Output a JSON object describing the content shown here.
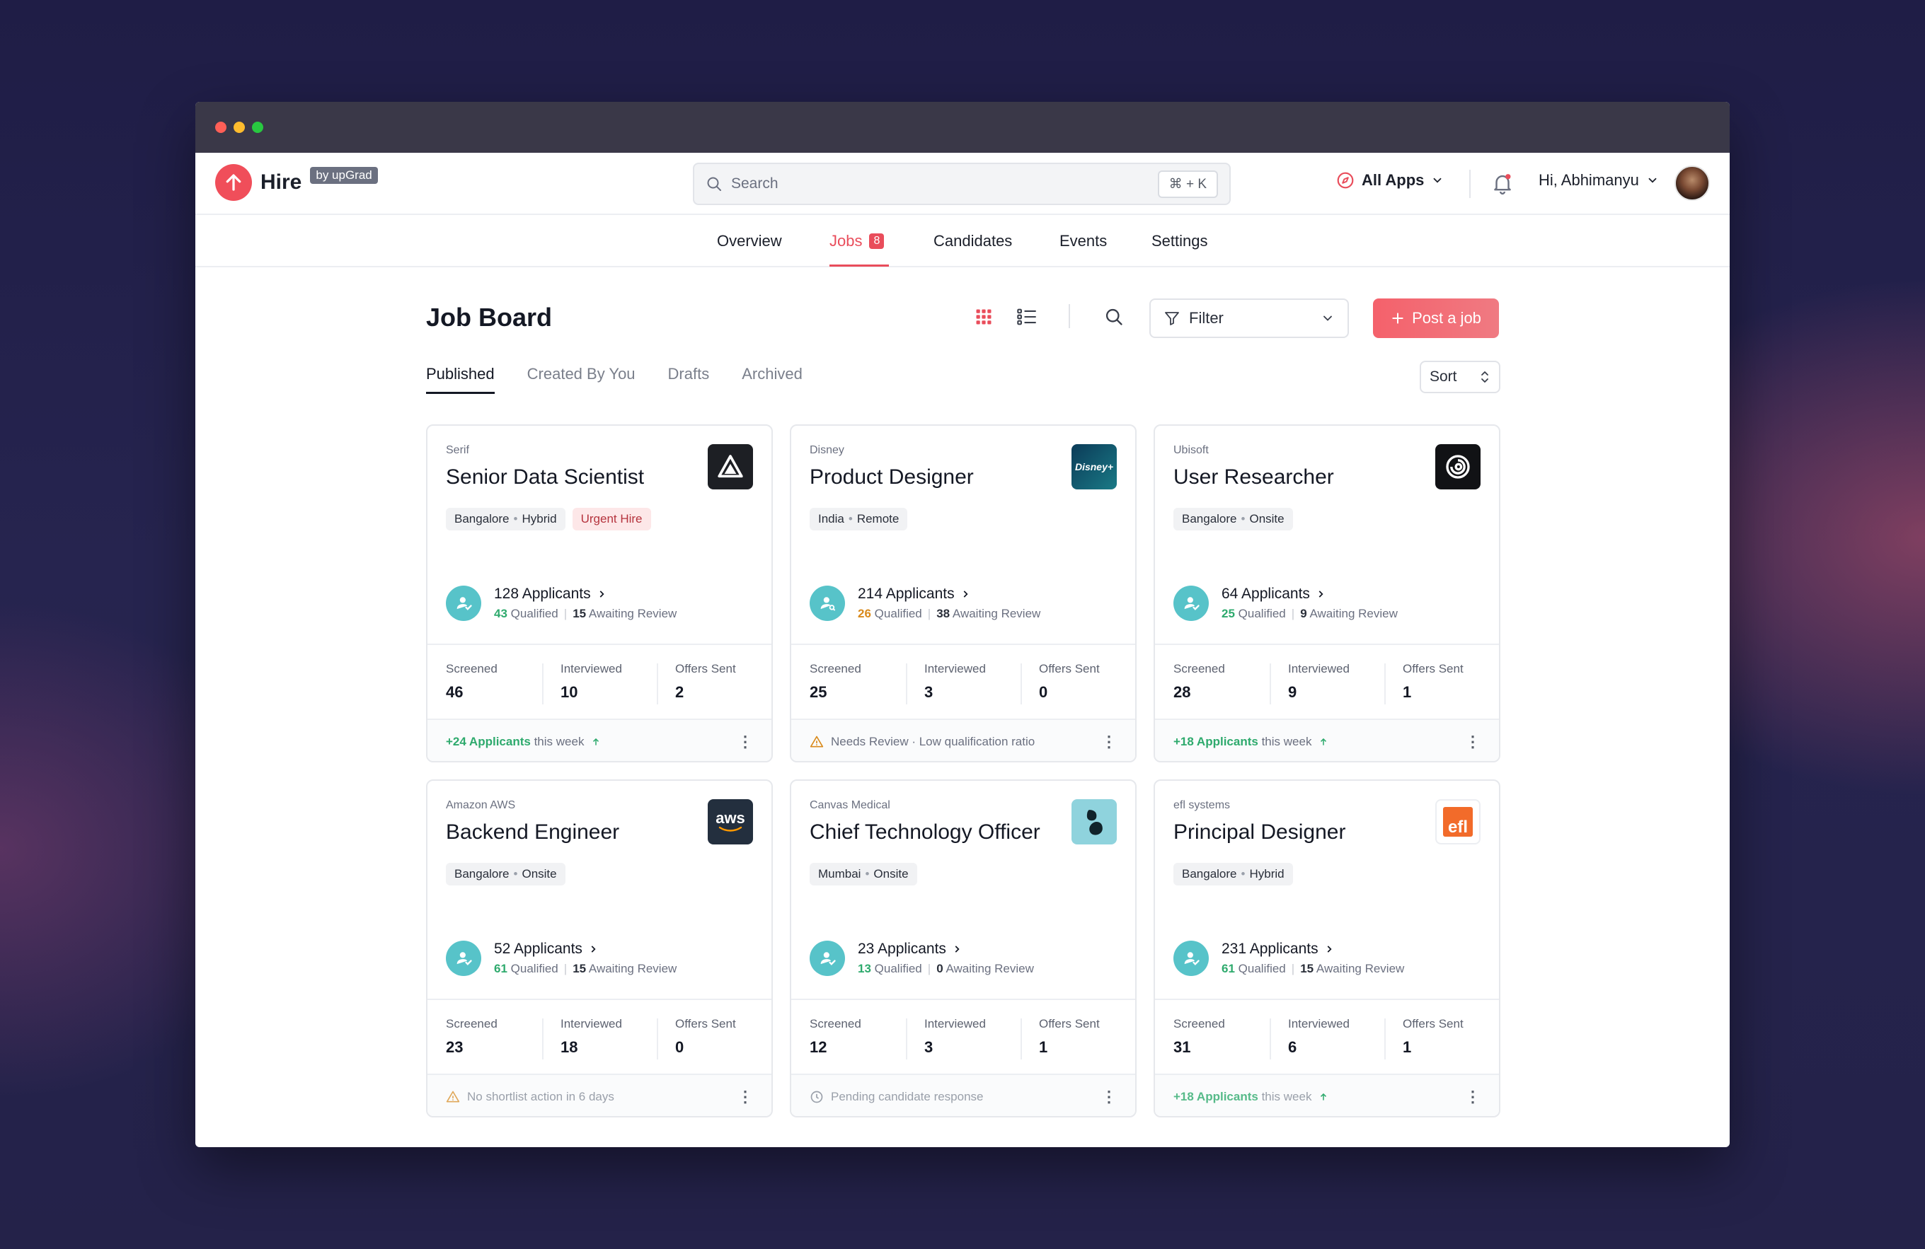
{
  "brand": {
    "name": "Hire",
    "sub": "by upGrad"
  },
  "search": {
    "placeholder": "Search",
    "shortcut": "⌘ + K"
  },
  "header": {
    "all_apps": "All Apps",
    "greeting": "Hi, Abhimanyu"
  },
  "nav": {
    "items": [
      {
        "label": "Overview"
      },
      {
        "label": "Jobs",
        "badge": "8",
        "active": true
      },
      {
        "label": "Candidates"
      },
      {
        "label": "Events"
      },
      {
        "label": "Settings"
      }
    ]
  },
  "page": {
    "title": "Job Board",
    "filter_label": "Filter",
    "post_label": "Post a job",
    "sort_label": "Sort",
    "tabs": [
      "Published",
      "Created By You",
      "Drafts",
      "Archived"
    ]
  },
  "stat_labels": {
    "screened": "Screened",
    "interviewed": "Interviewed",
    "offers": "Offers Sent"
  },
  "qualified_word": "Qualified",
  "awaiting_word": "Awaiting Review",
  "jobs": [
    {
      "company": "Serif",
      "title": "Senior Data Scientist",
      "location": "Bangalore",
      "mode": "Hybrid",
      "urgent": "Urgent Hire",
      "applicants": "128 Applicants",
      "qualified": "43",
      "awaiting": "15",
      "screened": "46",
      "interviewed": "10",
      "offers": "2",
      "footer_strong": "+24 Applicants",
      "footer_rest": "this week"
    },
    {
      "company": "Disney",
      "title": "Product Designer",
      "location": "India",
      "mode": "Remote",
      "applicants": "214 Applicants",
      "qualified": "26",
      "awaiting": "38",
      "screened": "25",
      "interviewed": "3",
      "offers": "0",
      "footer_text": "Needs Review · Low qualification ratio"
    },
    {
      "company": "Ubisoft",
      "title": "User Researcher",
      "location": "Bangalore",
      "mode": "Onsite",
      "applicants": "64 Applicants",
      "qualified": "25",
      "awaiting": "9",
      "screened": "28",
      "interviewed": "9",
      "offers": "1",
      "footer_strong": "+18 Applicants",
      "footer_rest": "this week"
    },
    {
      "company": "Amazon AWS",
      "title": "Backend Engineer",
      "location": "Bangalore",
      "mode": "Onsite",
      "applicants": "52 Applicants",
      "qualified": "61",
      "awaiting": "15",
      "screened": "23",
      "interviewed": "18",
      "offers": "0",
      "footer_text": "No shortlist action in 6 days"
    },
    {
      "company": "Canvas Medical",
      "title": "Chief Technology Officer",
      "location": "Mumbai",
      "mode": "Onsite",
      "applicants": "23 Applicants",
      "qualified": "13",
      "awaiting": "0",
      "screened": "12",
      "interviewed": "3",
      "offers": "1",
      "footer_text": "Pending candidate response"
    },
    {
      "company": "efl systems",
      "title": "Principal Designer",
      "location": "Bangalore",
      "mode": "Hybrid",
      "applicants": "231 Applicants",
      "qualified": "61",
      "awaiting": "15",
      "screened": "31",
      "interviewed": "6",
      "offers": "1",
      "footer_strong": "+18 Applicants",
      "footer_rest": "this week"
    }
  ],
  "logos": {
    "aws_text": "aws",
    "disney_text": "Disney+",
    "efl_text": "efl"
  },
  "colors": {
    "accent": "#e94d5b",
    "qualified_green": "#2eaa6d",
    "teal_icon": "#57c3c9"
  }
}
